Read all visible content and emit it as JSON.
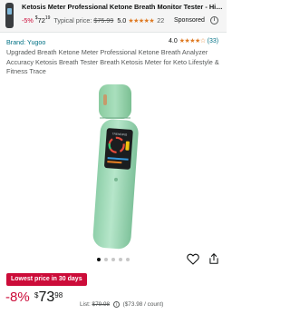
{
  "sponsored_ad": {
    "title": "Ketosis Meter Professional Ketone Breath Monitor Tester - High-...",
    "discount": "-5%",
    "price_symbol": "$",
    "price_whole": "72",
    "price_fraction": "19",
    "typical_label": "Typical price:",
    "typical_price": "$75.99",
    "rating": "5.0",
    "stars": "★★★★★",
    "review_count": "22",
    "sponsored_label": "Sponsored",
    "info_icon": "info-icon"
  },
  "product": {
    "brand": "Brand: Yugoo",
    "rating": "4.0",
    "stars": "★★★★☆",
    "review_count": "(33)",
    "title": "Upgraded Breath Ketone Meter Professional Ketone Breath Analyzer Accuracy Ketosis Breath Tester Breath Ketosis Meter for Keto Lifestyle & Fitness Trace",
    "image": {
      "device_color": "#a6dcbc",
      "device_label": "TRENDING",
      "image_count": 5,
      "active_image": 1
    },
    "wishlist_icon": "heart-icon",
    "share_icon": "share-icon",
    "deal_badge": "Lowest price in 30 days",
    "discount_percent": "-8%",
    "price_symbol": "$",
    "price_whole": "73",
    "price_fraction": "98",
    "list_label": "List:",
    "list_price": "$79.98",
    "unit_price": "($73.98 / count)"
  },
  "colors": {
    "accent_red": "#cc0c39",
    "link_teal": "#007185",
    "star_orange": "#de7921"
  }
}
